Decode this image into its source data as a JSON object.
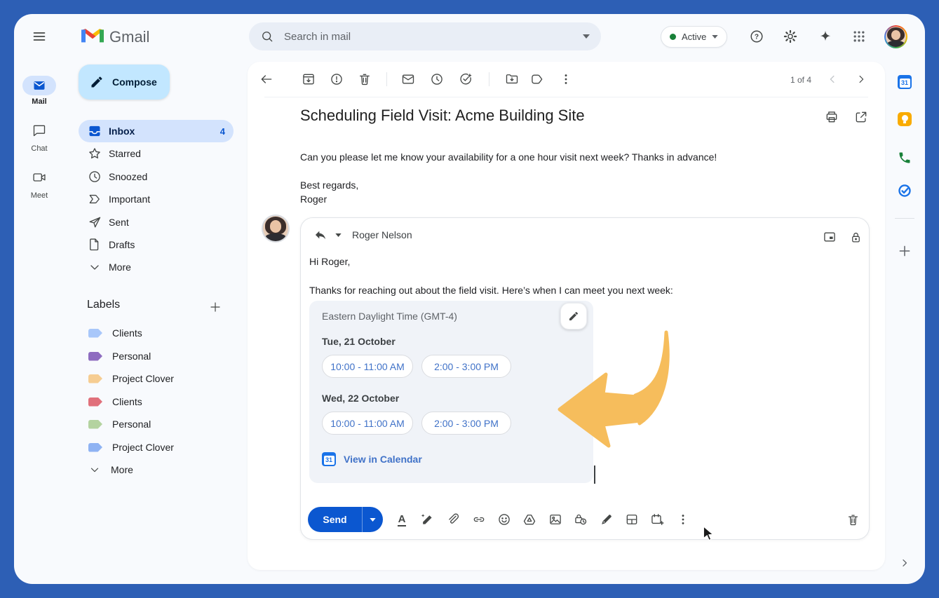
{
  "theme": {
    "frame-blue": "#2d5fb5",
    "app-bg": "#f8fafd",
    "accent-blue": "#0b57d0",
    "selected-blue": "#d3e3fd",
    "compose-blue": "#c2e7ff",
    "chip-blue": "#4072c8",
    "icon-gray": "#444746",
    "text-primary": "#1f1f1f",
    "text-secondary": "#5f6368",
    "card-gray": "#f0f3f8",
    "border-gray": "#dadce0",
    "arrow-orange": "#f6bd5c",
    "active-green": "#188038"
  },
  "header": {
    "app_name": "Gmail",
    "search_placeholder": "Search in mail",
    "active_label": "Active"
  },
  "rail": {
    "items": [
      {
        "label": "Mail"
      },
      {
        "label": "Chat"
      },
      {
        "label": "Meet"
      }
    ]
  },
  "sidebar": {
    "compose_label": "Compose",
    "items": [
      {
        "label": "Inbox",
        "count": "4"
      },
      {
        "label": "Starred"
      },
      {
        "label": "Snoozed"
      },
      {
        "label": "Important"
      },
      {
        "label": "Sent"
      },
      {
        "label": "Drafts"
      },
      {
        "label": "More"
      }
    ],
    "labels_header": "Labels",
    "labels": [
      {
        "label": "Clients",
        "color": "#a8c7fa"
      },
      {
        "label": "Personal",
        "color": "#8e6cc0"
      },
      {
        "label": "Project Clover",
        "color": "#f6cd92"
      },
      {
        "label": "Clients",
        "color": "#e0707b"
      },
      {
        "label": "Personal",
        "color": "#b4d3a0"
      },
      {
        "label": "Project Clover",
        "color": "#8fb3f3"
      },
      {
        "label": "More"
      }
    ]
  },
  "mail": {
    "pagination_label": "1 of 4",
    "subject": "Scheduling Field Visit: Acme Building Site",
    "body": "Can you please let me know your availability for a one hour visit next week? Thanks in advance!",
    "signoff_line1": "Best regards,",
    "signoff_line2": "Roger"
  },
  "reply": {
    "recipient": "Roger Nelson",
    "greeting": "Hi Roger,",
    "intro": "Thanks for reaching out about the field visit. Here’s when I can meet you next week:",
    "schedule": {
      "timezone": "Eastern Daylight Time (GMT-4)",
      "days": [
        {
          "date": "Tue, 21 October",
          "slots": [
            "10:00 - 11:00 AM",
            "2:00 - 3:00 PM"
          ]
        },
        {
          "date": "Wed, 22 October",
          "slots": [
            "10:00 - 11:00 AM",
            "2:00 - 3:00 PM"
          ]
        }
      ],
      "link_label": "View in Calendar"
    },
    "send_label": "Send"
  }
}
